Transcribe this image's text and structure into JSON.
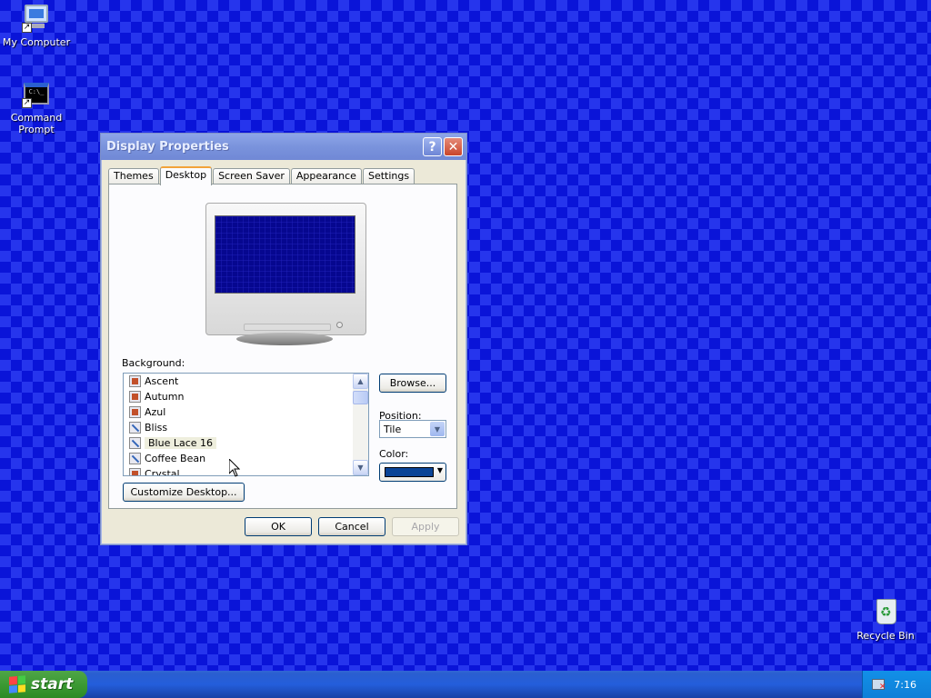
{
  "desktop": {
    "icons": [
      {
        "name": "my-computer",
        "label": "My Computer"
      },
      {
        "name": "command-prompt",
        "label": "Command Prompt"
      },
      {
        "name": "recycle-bin",
        "label": "Recycle Bin"
      }
    ],
    "cmd_glyph": "C:\\_"
  },
  "dialog": {
    "title": "Display Properties",
    "help_glyph": "?",
    "close_glyph": "✕",
    "tabs": [
      "Themes",
      "Desktop",
      "Screen Saver",
      "Appearance",
      "Settings"
    ],
    "active_tab": "Desktop",
    "background_label": "Background:",
    "backgrounds": [
      {
        "label": "Ascent",
        "icon": "bitmap-icon"
      },
      {
        "label": "Autumn",
        "icon": "bitmap-icon"
      },
      {
        "label": "Azul",
        "icon": "bitmap-icon"
      },
      {
        "label": "Bliss",
        "icon": "jpeg-icon"
      },
      {
        "label": "Blue Lace 16",
        "icon": "jpeg-icon",
        "selected": true
      },
      {
        "label": "Coffee Bean",
        "icon": "jpeg-icon"
      },
      {
        "label": "Crystal",
        "icon": "bitmap-icon"
      }
    ],
    "browse_label": "Browse...",
    "position_label": "Position:",
    "position_value": "Tile",
    "color_label": "Color:",
    "color_value": "#0a4496",
    "customize_label": "Customize Desktop...",
    "ok_label": "OK",
    "cancel_label": "Cancel",
    "apply_label": "Apply",
    "scroll_up": "▲",
    "scroll_down": "▼",
    "combo_arrow": "▼",
    "color_caret": "▼"
  },
  "taskbar": {
    "start_label": "start",
    "clock": "7:16"
  },
  "colors": {
    "desktop_background": "#0a14d8",
    "title_bar": "#7a93dc",
    "taskbar": "#245edb",
    "start_button": "#3c9a34",
    "tray": "#0e7fd8"
  }
}
